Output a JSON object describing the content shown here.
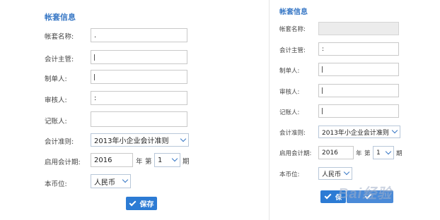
{
  "left": {
    "title": "帐套信息",
    "labels": {
      "name": "帐套名称:",
      "supervisor": "会计主管:",
      "preparer": "制单人:",
      "reviewer": "审核人:",
      "bookkeeper": "记账人:",
      "standard": "会计准则:",
      "start_period": "启用会计期:",
      "currency": "本币位:"
    },
    "values": {
      "name": ".",
      "supervisor": "",
      "preparer": "",
      "reviewer": ":",
      "bookkeeper": "",
      "standard": "2013年小企业会计准则",
      "year": "2016",
      "year_unit": "年",
      "period_prefix": "第",
      "period": "1",
      "period_unit": "期",
      "currency": "人民币"
    },
    "save_label": "保存"
  },
  "right": {
    "title": "帐套信息",
    "labels": {
      "name": "帐套名称:",
      "supervisor": "会计主管:",
      "preparer": "制单人:",
      "reviewer": "审核人:",
      "bookkeeper": "记账人:",
      "standard": "会计准则:",
      "start_period": "启用会计期:",
      "currency": "本币位:"
    },
    "values": {
      "name": "",
      "supervisor": ":",
      "preparer": "",
      "reviewer": "",
      "bookkeeper": "",
      "standard": "2013年小企业会计准则",
      "year": "2016",
      "year_unit": "年",
      "period_prefix": "第",
      "period": "1",
      "period_unit": "期",
      "currency": "人民币"
    },
    "save_label": "保"
  },
  "watermark_text": "Bai经验",
  "icons": {
    "select": "chevron-down-icon",
    "save": "check-icon"
  },
  "colors": {
    "accent": "#3a79c6",
    "button": "#2c7bd4"
  }
}
